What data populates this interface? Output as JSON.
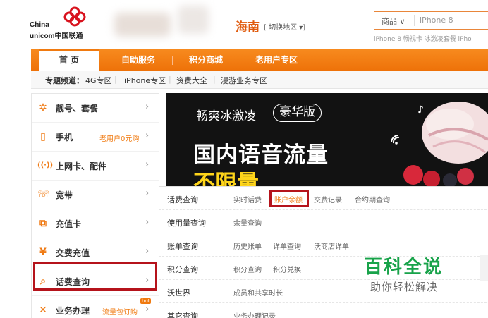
{
  "header": {
    "logo_line1": "China",
    "logo_line2": "unicom中国联通",
    "region": "海南",
    "region_switch": "[ 切换地区 ▾]",
    "search_category": "商品 ∨",
    "search_placeholder": "iPhone 8",
    "hot_words": "iPhone 8  畅视卡  冰激凌套餐  iPho"
  },
  "nav": {
    "items": [
      "首  页",
      "自助服务",
      "积分商城",
      "老用户专区"
    ]
  },
  "subnav": {
    "prefix": "专题频道：",
    "items": [
      "4G专区",
      "iPhone专区",
      "资费大全",
      "漫游业务专区"
    ]
  },
  "menu": {
    "items": [
      {
        "icon": "gear-icon",
        "label": "靓号、套餐",
        "promo": ""
      },
      {
        "icon": "phone-icon",
        "label": "手机",
        "promo": "老用户0元购"
      },
      {
        "icon": "signal-icon",
        "label": "上网卡、配件",
        "promo": ""
      },
      {
        "icon": "broadband-icon",
        "label": "宽带",
        "promo": ""
      },
      {
        "icon": "recharge-card-icon",
        "label": "充值卡",
        "promo": ""
      },
      {
        "icon": "yen-icon",
        "label": "交费充值",
        "promo": ""
      },
      {
        "icon": "search-icon",
        "label": "话费查询",
        "promo": ""
      },
      {
        "icon": "tools-icon",
        "label": "业务办理",
        "promo": "流量包订购",
        "badge": "hot"
      }
    ]
  },
  "banner": {
    "line1": "畅爽冰激凌",
    "pill": "豪华版",
    "line2": "国内语音流量",
    "line3": "不限量"
  },
  "dropdown": {
    "rows": [
      {
        "category": "话费查询",
        "links": [
          "实时话费",
          "账户余额",
          "交费记录",
          "合约期查询"
        ]
      },
      {
        "category": "使用量查询",
        "links": [
          "余量查询"
        ]
      },
      {
        "category": "账单查询",
        "links": [
          "历史账单",
          "详单查询",
          "沃商店详单"
        ]
      },
      {
        "category": "积分查询",
        "links": [
          "积分查询",
          "积分兑换"
        ]
      },
      {
        "category": "沃世界",
        "links": [
          "成员和共享时长"
        ]
      },
      {
        "category": "其它查询",
        "links": [
          "业务办理记录"
        ]
      }
    ]
  },
  "watermark": {
    "title": "百科全说",
    "subtitle": "助你轻松解决"
  },
  "colors": {
    "brand_orange": "#f07a10",
    "highlight_red": "#b5131b",
    "watermark_green": "#18a34a"
  }
}
